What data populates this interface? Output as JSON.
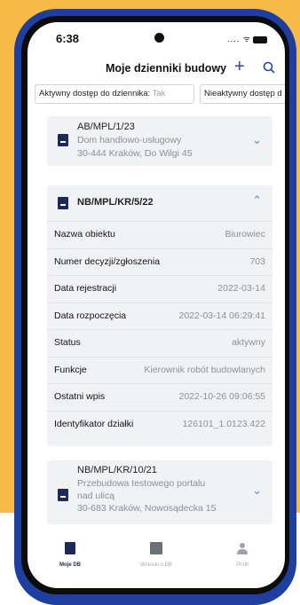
{
  "status_bar": {
    "time": "6:38",
    "signal": ".... ᯤ"
  },
  "header": {
    "title": "Moje dzienniki budowy",
    "add_label": "+"
  },
  "filters": [
    {
      "label": "Aktywny dostęp do dziennika:",
      "value": "Tak"
    },
    {
      "label": "Nieaktywny dostęp d",
      "value": ""
    }
  ],
  "cards": [
    {
      "code": "AB/MPL/1/23",
      "name": "Dom handlowo-usługowy",
      "address": "30-444 Kraków, Do Wilgi 45",
      "expanded": false
    },
    {
      "code": "NB/MPL/KR/5/22",
      "expanded": true,
      "details": [
        {
          "label": "Nazwa obiektu",
          "value": "Biurowiec"
        },
        {
          "label": "Numer decyzji/zgłoszenia",
          "value": "703"
        },
        {
          "label": "Data rejestracji",
          "value": "2022-03-14"
        },
        {
          "label": "Data rozpoczęcia",
          "value": "2022-03-14 06:29:41"
        },
        {
          "label": "Status",
          "value": "aktywny"
        },
        {
          "label": "Funkcje",
          "value": "Kierownik robót budowlanych"
        },
        {
          "label": "Ostatni wpis",
          "value": "2022-10-26 09:06:55"
        },
        {
          "label": "Identyfikator działki",
          "value": "126101_1.0123.422"
        }
      ]
    },
    {
      "code": "NB/MPL/KR/10/21",
      "name_line1": "Przebudowa testowego portalu",
      "name_line2": "nad ulicą",
      "address": "30-683 Kraków, Nowosądecka 15",
      "expanded": false
    }
  ],
  "tabs": [
    {
      "label": "Moje DB",
      "icon": "book-icon",
      "active": true
    },
    {
      "label": "Wnioski o DB",
      "icon": "documents-icon",
      "active": false
    },
    {
      "label": "Profil",
      "icon": "person-icon",
      "active": false
    }
  ],
  "colors": {
    "accent": "#1f46a8",
    "frame": "#1e3fa0",
    "background_yellow": "#f8bb48",
    "card": "#f1f2f5",
    "chevron": "#4d8fd6"
  }
}
